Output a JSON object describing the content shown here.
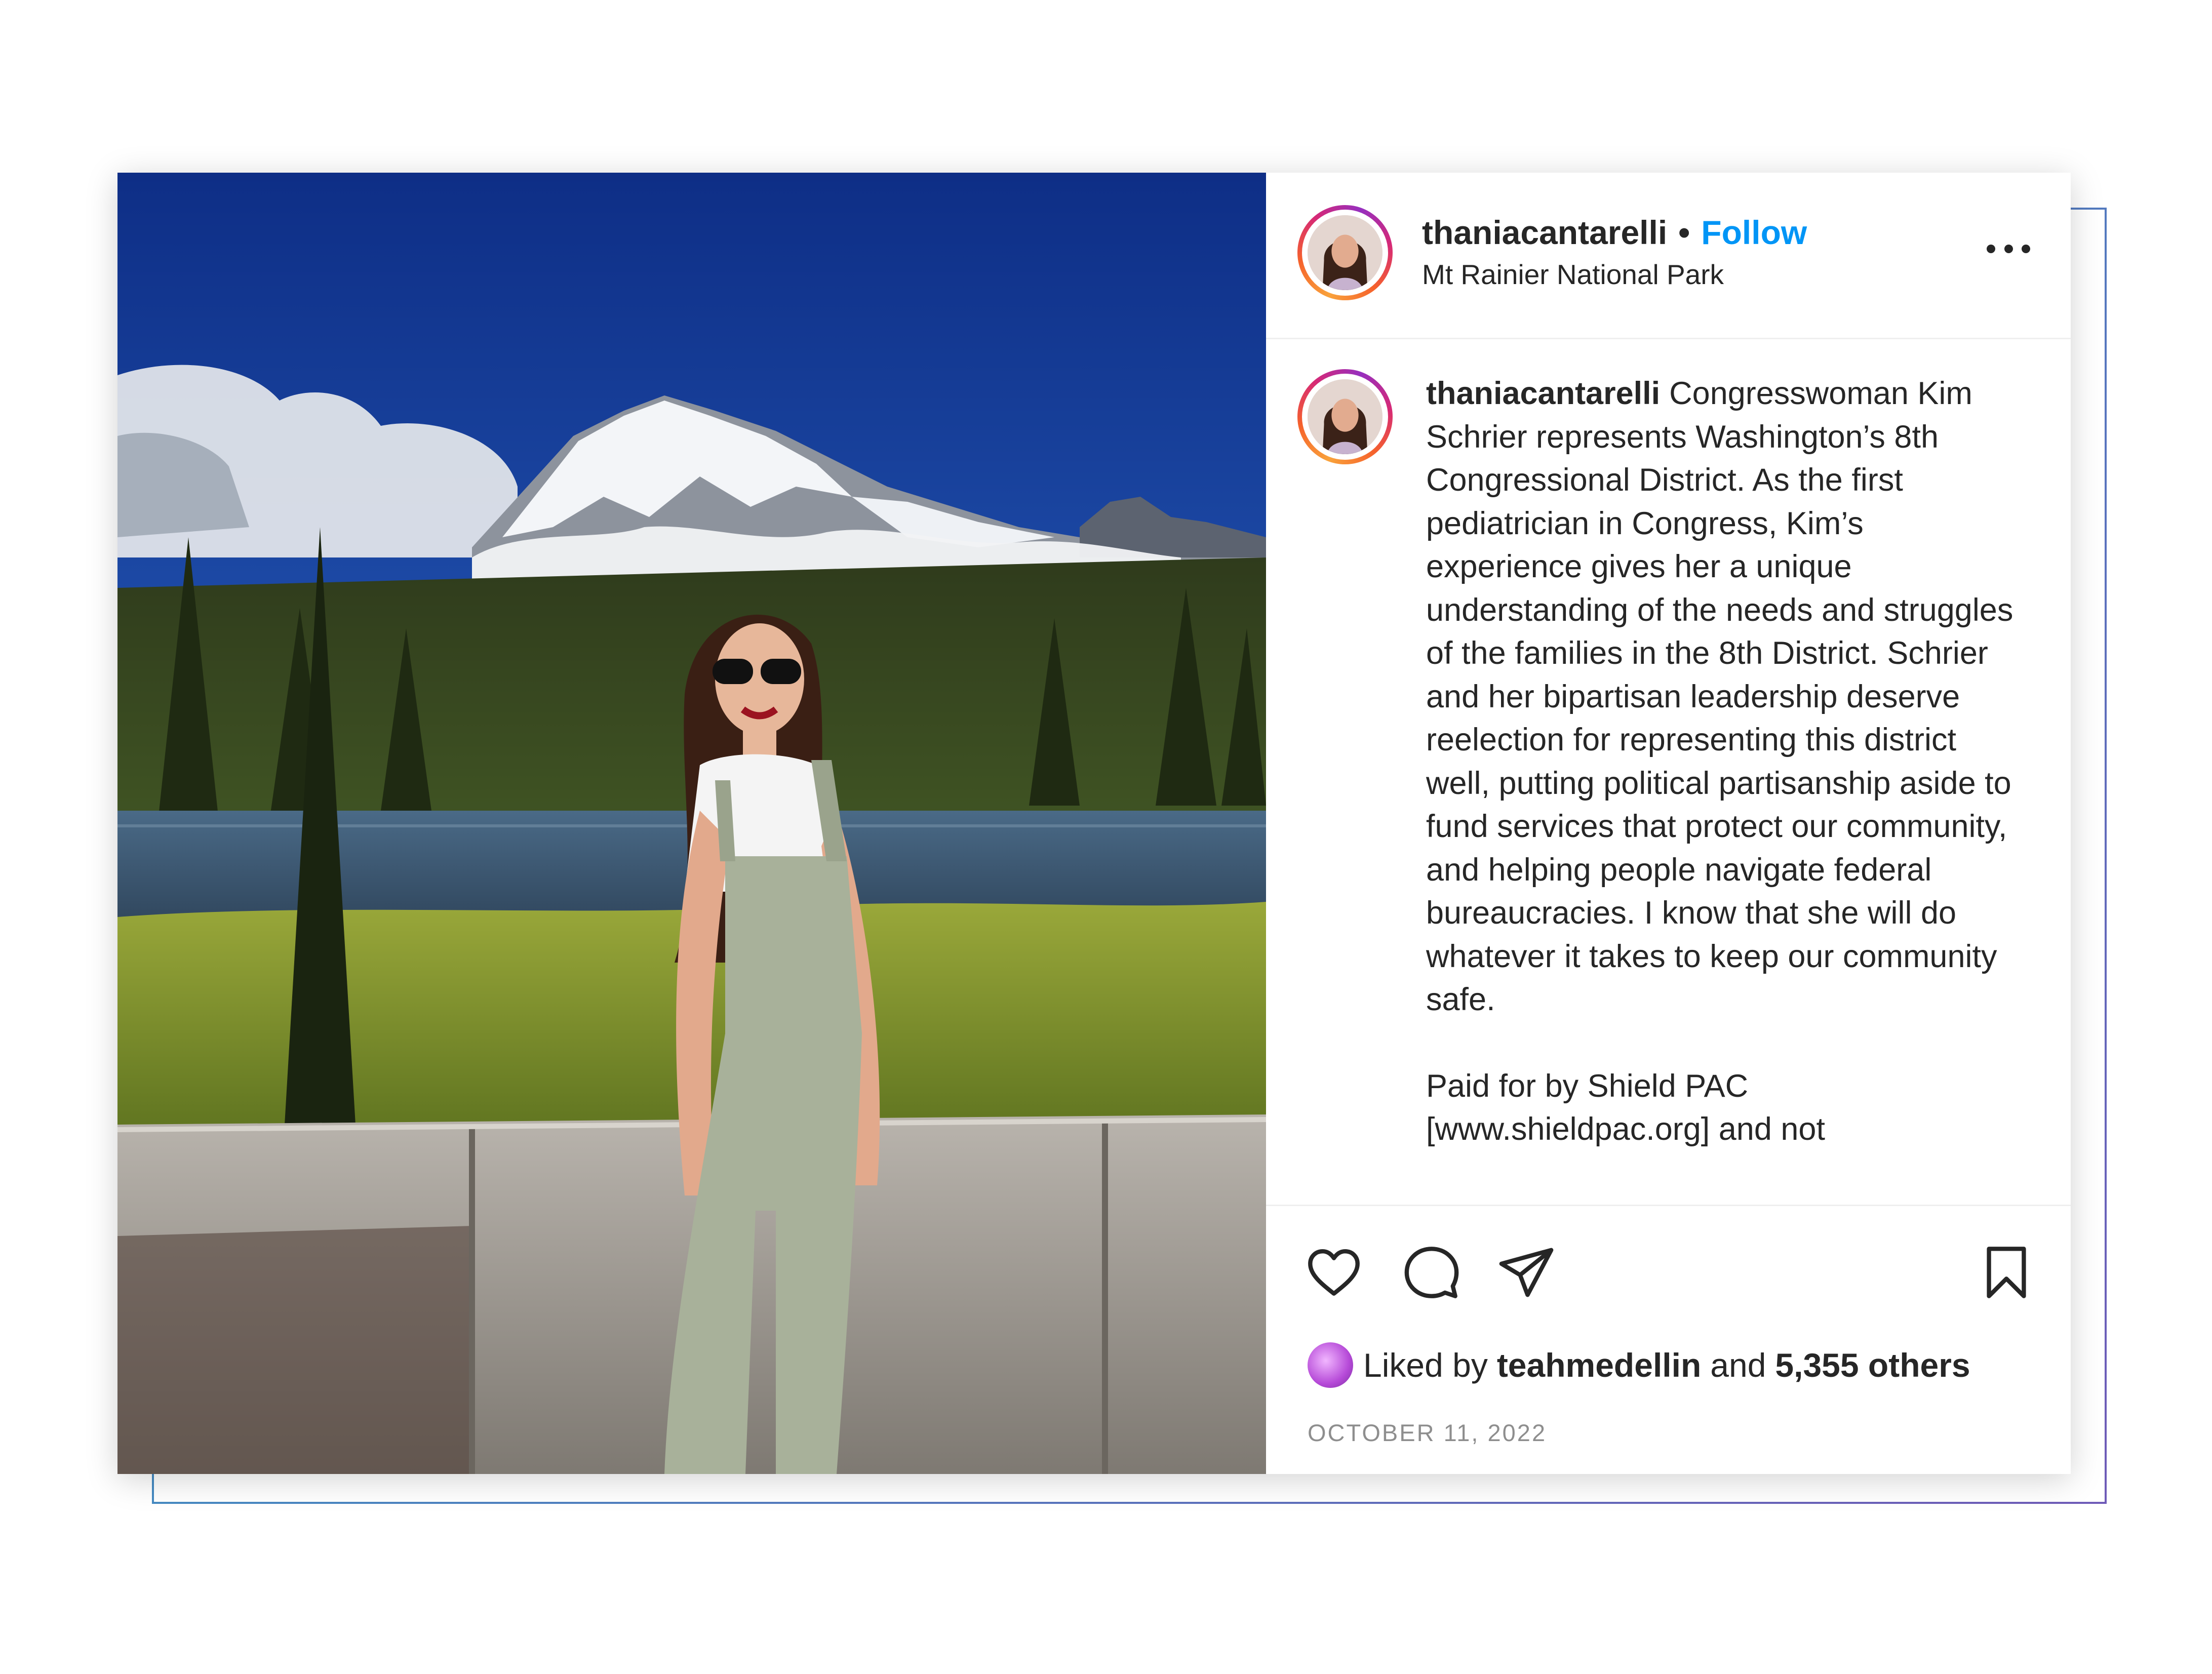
{
  "post": {
    "username": "thaniacantarelli",
    "separator": "•",
    "follow_label": "Follow",
    "location": "Mt Rainier National Park",
    "more_label": "More options",
    "caption_username": "thaniacantarelli",
    "caption_text": "Congresswoman Kim Schrier represents Washington’s 8th Congressional District. As the first pediatrician in Congress, Kim’s experience gives her a unique understanding of the needs and struggles of the families in the 8th District. Schrier and her bipartisan leadership deserve reelection for representing this district well, putting political partisanship aside to fund services that protect our community, and helping people navigate federal bureaucracies. I know that she will do whatever it takes to keep our community safe.",
    "caption_disclaimer": "Paid for by Shield PAC [www.shieldpac.org] and not",
    "likes_prefix": "Liked by",
    "liked_by_user": "teahmedellin",
    "likes_and": "and",
    "likes_others": "5,355 others",
    "date": "OCTOBER 11, 2022"
  },
  "icons": {
    "like": "heart-icon",
    "comment": "comment-icon",
    "share": "share-icon",
    "save": "bookmark-icon",
    "more": "more-horizontal-icon"
  },
  "colors": {
    "follow_blue": "#0095f6",
    "text": "#262626",
    "muted": "#8e8e8e",
    "frame_gradient_start": "#2aa9c9",
    "frame_gradient_end": "#6f5bb8"
  }
}
